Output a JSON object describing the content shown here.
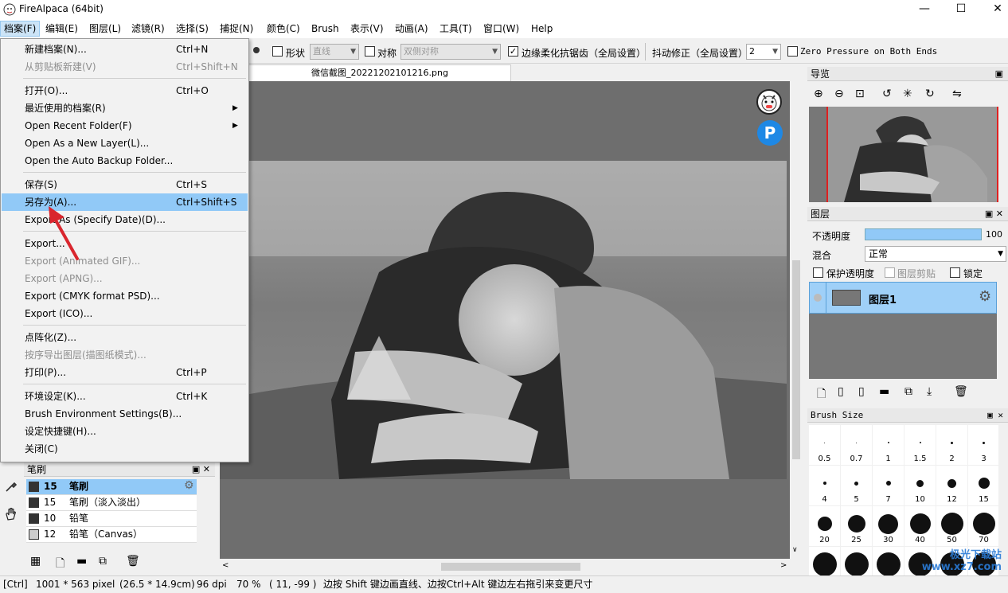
{
  "app": {
    "title": "FireAlpaca (64bit)",
    "minimize": "—",
    "maximize": "☐",
    "close": "✕"
  },
  "menubar": [
    "档案(F)",
    "编辑(E)",
    "图层(L)",
    "滤镜(R)",
    "选择(S)",
    "捕捉(N)",
    "颜色(C)",
    "Brush",
    "表示(V)",
    "动画(A)",
    "工具(T)",
    "窗口(W)",
    "Help"
  ],
  "toolbar": {
    "shape_label": "形状",
    "shape_value": "直线",
    "symmetry_label": "对称",
    "symmetry_value": "双侧对称",
    "antialias_label": "边缘柔化抗锯齿（全局设置）",
    "stabilizer_label": "抖动修正（全局设置）",
    "stabilizer_value": "2",
    "zero_pressure_label": "Zero Pressure on Both Ends"
  },
  "document_tab": "微信截图_20221202101216.png",
  "file_menu": [
    {
      "label": "新建档案(N)...",
      "shortcut": "Ctrl+N"
    },
    {
      "label": "从剪贴板新建(V)",
      "shortcut": "Ctrl+Shift+N",
      "disabled": true
    },
    {
      "sep": true
    },
    {
      "label": "打开(O)...",
      "shortcut": "Ctrl+O"
    },
    {
      "label": "最近使用的档案(R)",
      "submenu": true
    },
    {
      "label": "Open Recent Folder(F)",
      "submenu": true
    },
    {
      "label": "Open As a New Layer(L)..."
    },
    {
      "label": "Open the Auto Backup Folder..."
    },
    {
      "sep": true
    },
    {
      "label": "保存(S)",
      "shortcut": "Ctrl+S"
    },
    {
      "label": "另存为(A)...",
      "shortcut": "Ctrl+Shift+S",
      "highlighted": true
    },
    {
      "label": "Export As (Specify Date)(D)..."
    },
    {
      "sep": true
    },
    {
      "label": "Export..."
    },
    {
      "label": "Export (Animated GIF)...",
      "disabled": true
    },
    {
      "label": "Export (APNG)...",
      "disabled": true
    },
    {
      "label": "Export (CMYK format PSD)..."
    },
    {
      "label": "Export (ICO)..."
    },
    {
      "sep": true
    },
    {
      "label": "点阵化(Z)..."
    },
    {
      "label": "按序导出图层(描图纸模式)...",
      "disabled": true
    },
    {
      "label": "打印(P)...",
      "shortcut": "Ctrl+P"
    },
    {
      "sep": true
    },
    {
      "label": "环境设定(K)...",
      "shortcut": "Ctrl+K"
    },
    {
      "label": "Brush Environment Settings(B)..."
    },
    {
      "label": "设定快捷键(H)..."
    },
    {
      "label": "关闭(C)"
    }
  ],
  "navigator": {
    "title": "导览"
  },
  "layers": {
    "title": "图层",
    "opacity_label": "不透明度",
    "opacity_value": "100",
    "opacity_pct": 100,
    "opacity_unit": "%",
    "blend_label": "混合",
    "blend_value": "正常",
    "protect_alpha": "保护透明度",
    "clipping": "图层剪贴",
    "lock": "锁定",
    "layer_name": "图层1"
  },
  "brush_size": {
    "title": "Brush Size",
    "sizes": [
      "0.5",
      "0.7",
      "1",
      "1.5",
      "2",
      "3",
      "4",
      "5",
      "7",
      "10",
      "12",
      "15",
      "20",
      "25",
      "30",
      "40",
      "50",
      "70",
      "",
      "",
      "",
      "",
      "",
      ""
    ]
  },
  "brush_panel": {
    "title": "笔刷",
    "items": [
      {
        "size": "15",
        "name": "笔刷",
        "selected": true
      },
      {
        "size": "15",
        "name": "笔刷（淡入淡出）"
      },
      {
        "size": "10",
        "name": "铅笔"
      },
      {
        "size": "12",
        "name": "铅笔（Canvas）"
      }
    ]
  },
  "status": {
    "mode": "[Ctrl]",
    "size": "1001 * 563 pixel",
    "physical": "(26.5 * 14.9cm)",
    "dpi": "96 dpi",
    "zoom": "70 %",
    "coords": "( 11, -99 )",
    "hint": "边按 Shift 键边画直线、边按Ctrl+Alt 键边左右拖引来变更尺寸"
  },
  "watermark": "极光下载站 www.xz7.com",
  "colors": {
    "accent": "#91c9f7",
    "canvas_bg": "#6e6e6e",
    "arrow": "#d9262e"
  }
}
